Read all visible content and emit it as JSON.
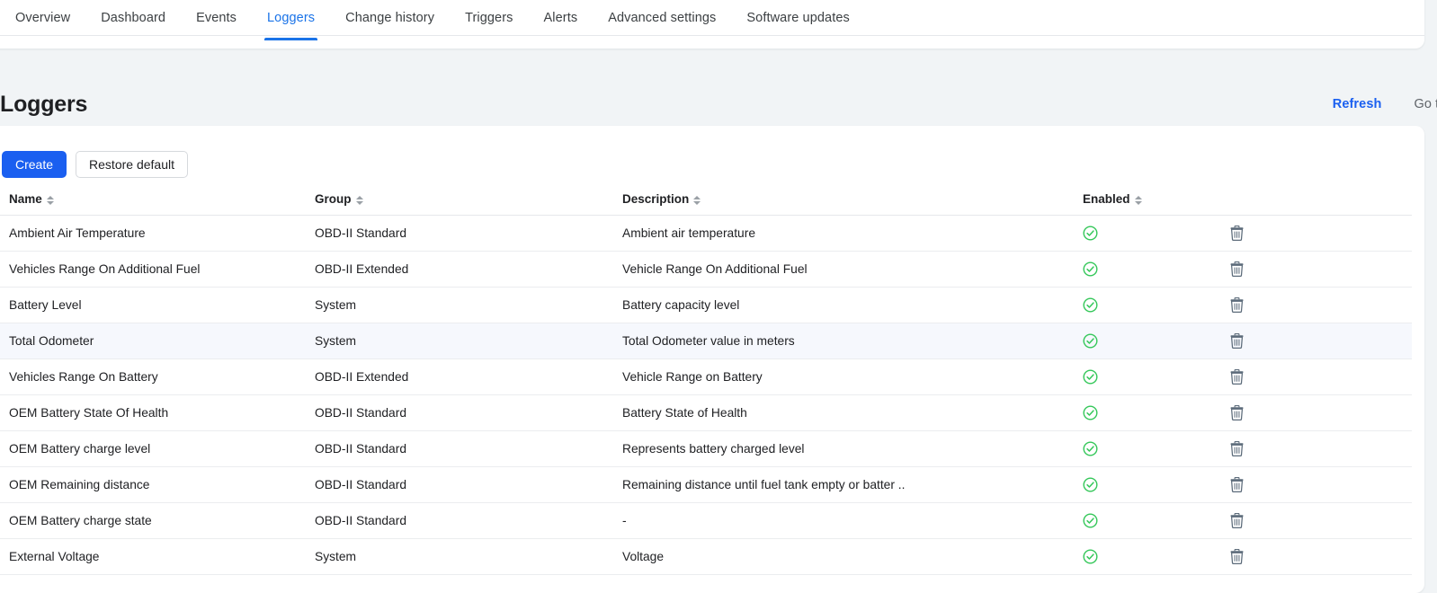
{
  "nav": {
    "tabs": [
      {
        "label": "Overview",
        "active": false
      },
      {
        "label": "Dashboard",
        "active": false
      },
      {
        "label": "Events",
        "active": false
      },
      {
        "label": "Loggers",
        "active": true
      },
      {
        "label": "Change history",
        "active": false
      },
      {
        "label": "Triggers",
        "active": false
      },
      {
        "label": "Alerts",
        "active": false
      },
      {
        "label": "Advanced settings",
        "active": false
      },
      {
        "label": "Software updates",
        "active": false
      }
    ]
  },
  "header": {
    "title": "Loggers",
    "refresh_label": "Refresh",
    "docs_label": "Go to Docs"
  },
  "toolbar": {
    "create_label": "Create",
    "restore_label": "Restore default"
  },
  "table": {
    "columns": [
      {
        "label": "Name",
        "sortable": true
      },
      {
        "label": "Group",
        "sortable": true
      },
      {
        "label": "Description",
        "sortable": true
      },
      {
        "label": "Enabled",
        "sortable": true
      },
      {
        "label": "",
        "sortable": false
      }
    ],
    "rows": [
      {
        "name": "Ambient Air Temperature",
        "group": "OBD-II Standard",
        "description": "Ambient air temperature",
        "enabled": true,
        "highlight": false
      },
      {
        "name": "Vehicles Range On Additional Fuel",
        "group": "OBD-II Extended",
        "description": "Vehicle Range On Additional Fuel",
        "enabled": true,
        "highlight": false
      },
      {
        "name": "Battery Level",
        "group": "System",
        "description": "Battery capacity level",
        "enabled": true,
        "highlight": false
      },
      {
        "name": "Total Odometer",
        "group": "System",
        "description": "Total Odometer value in meters",
        "enabled": true,
        "highlight": true
      },
      {
        "name": "Vehicles Range On Battery",
        "group": "OBD-II Extended",
        "description": "Vehicle Range on Battery",
        "enabled": true,
        "highlight": false
      },
      {
        "name": "OEM Battery State Of Health",
        "group": "OBD-II Standard",
        "description": "Battery State of Health",
        "enabled": true,
        "highlight": false
      },
      {
        "name": "OEM Battery charge level",
        "group": "OBD-II Standard",
        "description": "Represents battery charged level",
        "enabled": true,
        "highlight": false
      },
      {
        "name": "OEM Remaining distance",
        "group": "OBD-II Standard",
        "description": "Remaining distance until fuel tank empty or batter ..",
        "enabled": true,
        "highlight": false
      },
      {
        "name": "OEM Battery charge state",
        "group": "OBD-II Standard",
        "description": "-",
        "enabled": true,
        "highlight": false
      },
      {
        "name": "External Voltage",
        "group": "System",
        "description": "Voltage",
        "enabled": true,
        "highlight": false
      }
    ],
    "enabled_icon": "check-circle-icon",
    "delete_icon": "trash-icon",
    "sort_icon": "sort-arrows-icon"
  },
  "colors": {
    "accent_blue": "#1a5ff0",
    "tab_active_blue": "#1a73e8",
    "enabled_green": "#34c759",
    "trash_gray": "#5c6b7a",
    "page_bg": "#f1f4f6",
    "row_highlight": "#f6f8fd"
  }
}
